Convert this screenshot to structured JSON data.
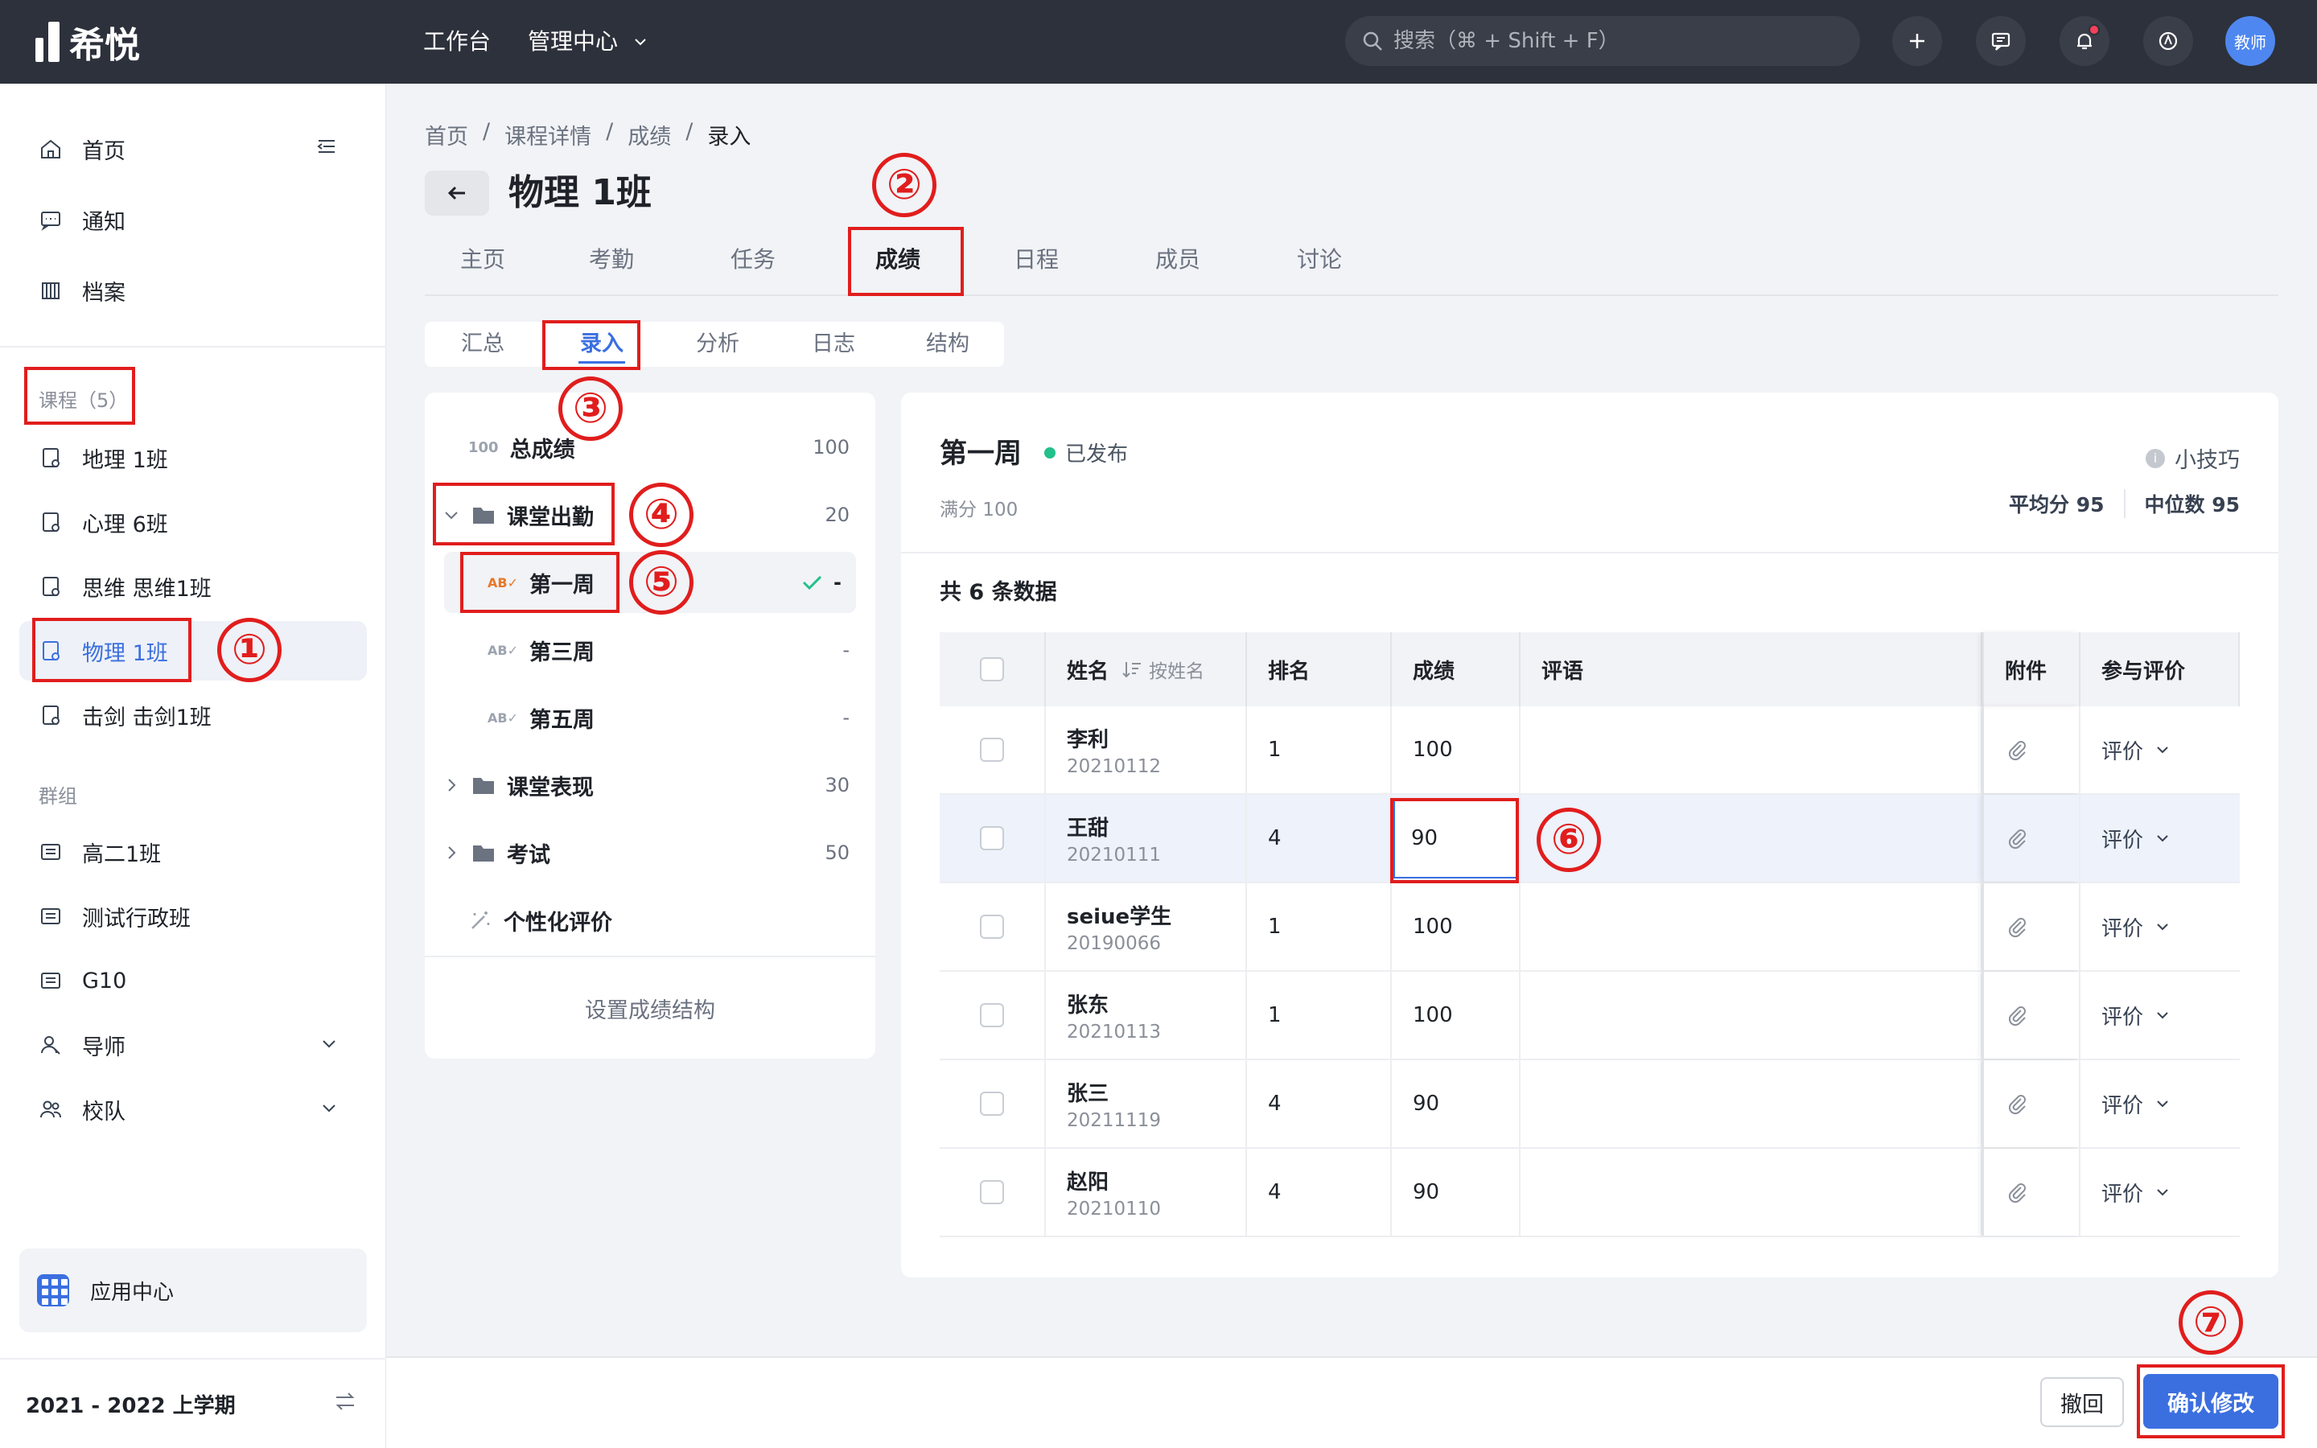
{
  "app": {
    "brand": "希悦"
  },
  "topbar": {
    "nav": [
      "工作台",
      "管理中心"
    ],
    "search_placeholder": "搜索（⌘ + Shift + F）",
    "avatar": "教师"
  },
  "sidebar": {
    "main": [
      "首页",
      "通知",
      "档案"
    ],
    "courses_header": "课程（5）",
    "courses": [
      "地理 1班",
      "心理 6班",
      "思维 思维1班",
      "物理 1班",
      "击剑 击剑1班"
    ],
    "groups_header": "群组",
    "groups": [
      "高二1班",
      "测试行政班",
      "G10",
      "导师",
      "校队"
    ],
    "app_center": "应用中心",
    "semester": "2021 - 2022 上学期"
  },
  "breadcrumb": [
    "首页",
    "课程详情",
    "成绩",
    "录入"
  ],
  "page_title": "物理 1班",
  "tabs": [
    "主页",
    "考勤",
    "任务",
    "成绩",
    "日程",
    "成员",
    "讨论"
  ],
  "subtabs": [
    "汇总",
    "录入",
    "分析",
    "日志",
    "结构"
  ],
  "tree": {
    "total": {
      "label": "总成绩",
      "count": "100"
    },
    "attendance": {
      "label": "课堂出勤",
      "count": "20"
    },
    "week1": {
      "label": "第一周",
      "count": "-"
    },
    "week3": {
      "label": "第三周",
      "count": "-"
    },
    "week5": {
      "label": "第五周",
      "count": "-"
    },
    "performance": {
      "label": "课堂表现",
      "count": "30"
    },
    "exam": {
      "label": "考试",
      "count": "50"
    },
    "personal": {
      "label": "个性化评价"
    },
    "footer": "设置成绩结构"
  },
  "content": {
    "title": "第一周",
    "status": "已发布",
    "tips": "小技巧",
    "full_score": "满分 100",
    "avg": "平均分 95",
    "median": "中位数 95",
    "count": "共 6 条数据"
  },
  "table": {
    "headers": {
      "name": "姓名",
      "sort": "按姓名",
      "rank": "排名",
      "score": "成绩",
      "comment": "评语",
      "attach": "附件",
      "eval": "参与评价"
    },
    "eval_label": "评价",
    "rows": [
      {
        "name": "李利",
        "id": "20210112",
        "rank": "1",
        "score": "100"
      },
      {
        "name": "王甜",
        "id": "20210111",
        "rank": "4",
        "score": "90"
      },
      {
        "name": "seiue学生",
        "id": "20190066",
        "rank": "1",
        "score": "100"
      },
      {
        "name": "张东",
        "id": "20210113",
        "rank": "1",
        "score": "100"
      },
      {
        "name": "张三",
        "id": "20211119",
        "rank": "4",
        "score": "90"
      },
      {
        "name": "赵阳",
        "id": "20210110",
        "rank": "4",
        "score": "90"
      }
    ]
  },
  "buttons": {
    "undo": "撤回",
    "confirm": "确认修改"
  },
  "annotations": [
    "①",
    "②",
    "③",
    "④",
    "⑤",
    "⑥",
    "⑦"
  ],
  "colors": {
    "accent": "#3b6fe0",
    "topbar": "#2d313b",
    "annotation": "#e11d1d",
    "published": "#22c08a"
  }
}
